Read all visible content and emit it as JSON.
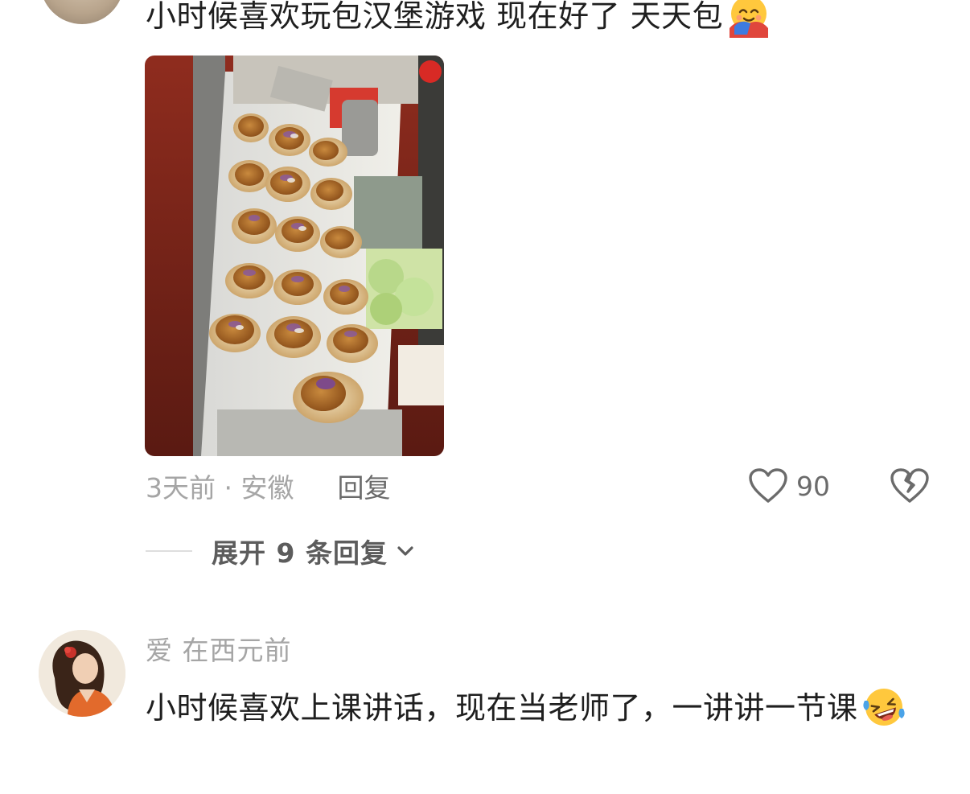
{
  "comment1": {
    "text": "小时候喜欢玩包汉堡游戏 现在好了 天天包",
    "emoji": "smiling-face-with-hug-emoji",
    "time_location": "3天前 · 安徽",
    "reply_label": "回复",
    "like_count": "90",
    "expand_label": "展开 9 条回复",
    "photo": "burger-assembly-photo"
  },
  "comment2": {
    "username": "爱 在西元前",
    "text": "小时候喜欢上课讲话，现在当老师了，一讲讲一节课",
    "emoji": "rolling-laughing-emoji"
  },
  "colors": {
    "text_primary": "#1f1f1f",
    "text_secondary": "#a5a5a5",
    "text_action": "#6b6b6b"
  }
}
